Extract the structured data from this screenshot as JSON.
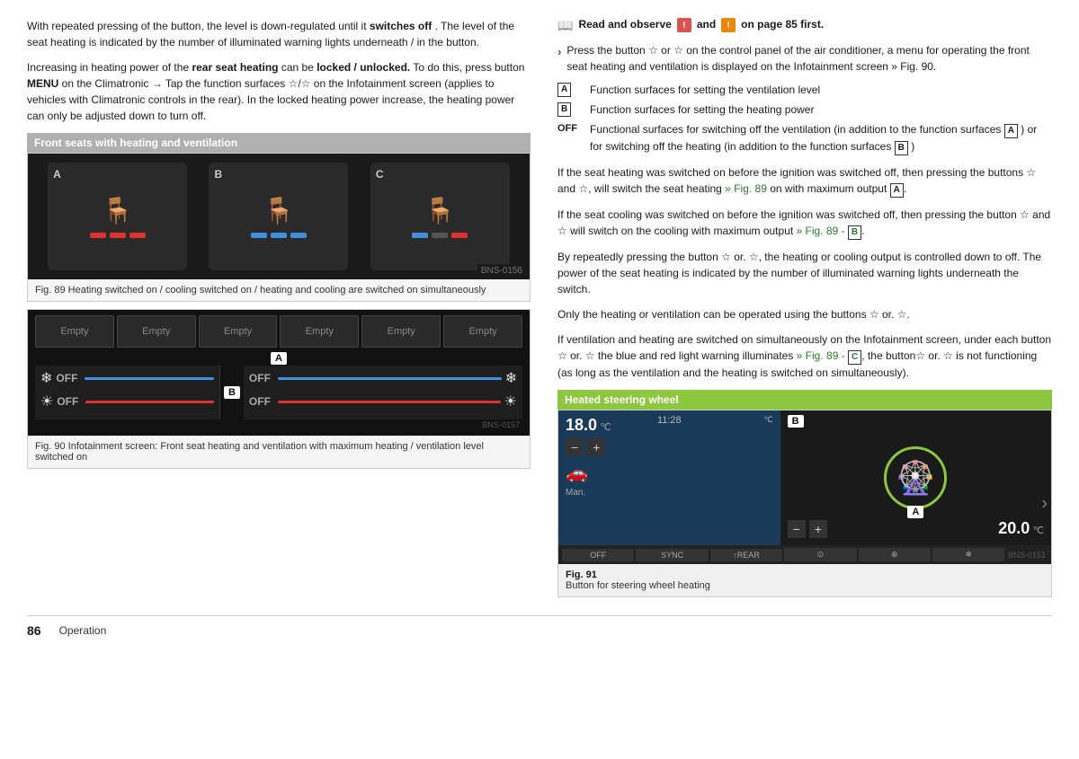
{
  "page": {
    "number": "86",
    "section": "Operation"
  },
  "left": {
    "para1": "With repeated pressing of the button, the level is down-regulated until it switches off . The level of the seat heating is indicated by the number of illuminated warning lights underneath / in the button.",
    "para1_bold": "switches off",
    "para2_start": "Increasing in heating power of the ",
    "para2_bold": "rear seat heating",
    "para2_mid": " can be ",
    "para2_bold2": "locked / unlocked.",
    "para2_rest": " To do this, press button MENU on the Climatronic → Tap the function surfaces ☆/☆ on the Infotainment screen (applies to vehicles with Climatronic controls in the rear). In the locked heating power increase, the heating power can only be adjusted down to turn off.",
    "section1_title": "Front seats with heating and ventilation",
    "fig89_labels": [
      "A",
      "B",
      "C"
    ],
    "fig89_code": "BNS-0156",
    "fig89_caption": "Fig. 89   Heating switched on / cooling switched on / heating and cooling are switched on simultaneously",
    "info_screen": {
      "empty_labels": [
        "Empty",
        "Empty",
        "Empty",
        "Empty",
        "Empty",
        "Empty"
      ],
      "a_label": "A",
      "b_label": "B",
      "left_rows": [
        {
          "icon": "❄",
          "off": "OFF",
          "color": "blue"
        },
        {
          "icon": "☀",
          "off": "OFF",
          "color": "red"
        }
      ],
      "right_rows": [
        {
          "icon": "❄",
          "off": "OFF",
          "color": "blue"
        },
        {
          "icon": "☀",
          "off": "OFF",
          "color": "red"
        }
      ]
    },
    "fig90_code": "BNS-0157",
    "fig90_caption": "Fig. 90   Infotainment screen: Front seat heating and ventilation with maximum heating / ventilation level switched on"
  },
  "right": {
    "read_observe": "Read and observe",
    "read_observe_page": "and",
    "read_observe_end": "on page 85 first.",
    "bullet1": "Press the button ☆ or ☆ on the control panel of the air conditioner, a menu for operating the front seat heating and ventilation is displayed on the Infotainment screen » Fig. 90.",
    "func_rows": [
      {
        "key": "A",
        "boxed": true,
        "text": "Function surfaces for setting the ventilation level"
      },
      {
        "key": "B",
        "boxed": true,
        "text": "Function surfaces for setting the heating power"
      },
      {
        "key": "OFF",
        "boxed": false,
        "text": "Functional surfaces for switching off the ventilation (in addition to the function surfaces A ) or for switching off the heating (in addition to the function surfaces B )"
      }
    ],
    "para_heat1": "If the seat heating was switched on before the ignition was switched off, then pressing the buttons ☆ and ☆, will switch the seat heating » Fig. 89 on with maximum output A.",
    "para_heat2": "If the seat cooling was switched on before the ignition was switched off, then pressing the button ☆ and ☆ will switch on the cooling with maximum output » Fig. 89 - B.",
    "para_heat3": "By repeatedly pressing the button ☆ or. ☆, the heating or cooling output is controlled down to off. The power of the seat heating is indicated by the number of illuminated warning lights underneath the switch.",
    "para_heat4": "Only the heating or ventilation can be operated using the buttons ☆ or. ☆.",
    "para_heat5": "If ventilation and heating are switched on simultaneously on the Infotainment screen, under each button ☆ or. ☆ the blue and red light warning illuminates » Fig. 89 - C, the button☆ or. ☆ is not functioning (as long as the ventilation and the heating is switched on simultaneously).",
    "section2_title": "Heated steering wheel",
    "fig91": {
      "time": "11:28",
      "temp_left": "18.0",
      "temp_unit_left": "℃",
      "temp_right": "20.0",
      "temp_unit_right": "℃",
      "b_label": "B",
      "a_label": "A",
      "code": "BNS-0151",
      "caption_num": "Fig. 91",
      "caption_text": "Button for steering wheel heating",
      "climate_btns": [
        "OFF",
        "SYNC",
        "↑REAR",
        "⊙",
        "▽",
        "❄"
      ]
    }
  }
}
